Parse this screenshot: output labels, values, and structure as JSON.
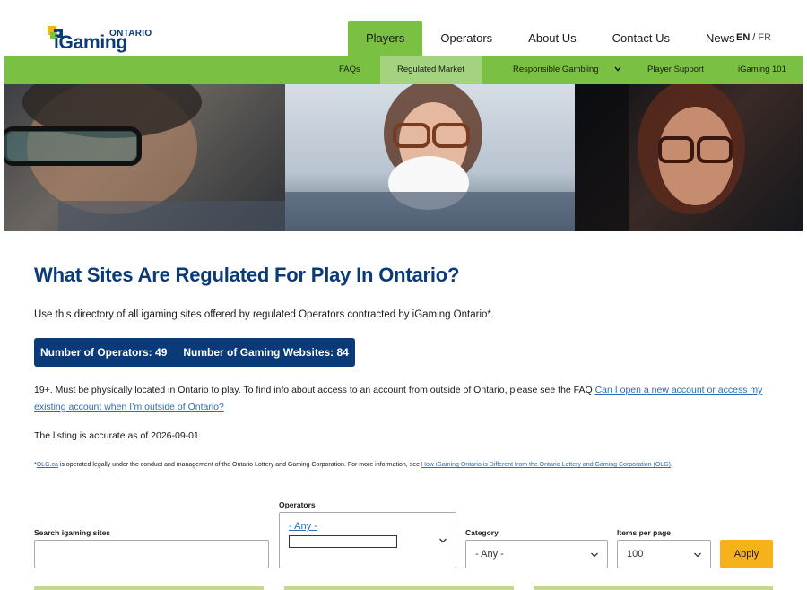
{
  "header": {
    "logo": {
      "top": "ONTARIO",
      "main": "iGaming"
    },
    "nav": [
      {
        "label": "Players",
        "active": true
      },
      {
        "label": "Operators",
        "active": false
      },
      {
        "label": "About Us",
        "active": false
      },
      {
        "label": "Contact Us",
        "active": false
      },
      {
        "label": "News",
        "active": false
      }
    ],
    "lang": {
      "en": "EN",
      "separator": "/",
      "fr": "FR"
    }
  },
  "subnav": [
    {
      "label": "FAQs"
    },
    {
      "label": "Regulated Market",
      "active": true
    },
    {
      "label": "Responsible Gambling",
      "has_dropdown": true
    },
    {
      "label": "Player Support"
    },
    {
      "label": "iGaming 101"
    }
  ],
  "content": {
    "title": "What Sites Are Regulated For Play In Ontario?",
    "intro": "Use this directory of all igaming sites offered by regulated Operators contracted by iGaming Ontario*.",
    "stats": {
      "operators": "Number of Operators: 49",
      "websites": "Number of Gaming Websites: 84"
    },
    "notice_text": "19+. Must be physically located in Ontario to play. To find info about access to an account from outside of Ontario, please see the FAQ ",
    "notice_link": "Can I open a new account or access my existing account when I’m outside of Ontario?",
    "as_of": "The listing is accurate as of 2026-09-01.",
    "fine_prefix": "*",
    "fine_link1": "OLG.ca",
    "fine_mid": " is operated legally under the conduct and management of the Ontario Lottery and Gaming Corporation. For more information, see ",
    "fine_link2": "How iGaming Ontario is Different from the Ontario Lottery and Gaming Corporation (OLG)",
    "fine_end": "."
  },
  "filters": {
    "search": {
      "label": "Search igaming sites",
      "value": ""
    },
    "operators": {
      "label": "Operators",
      "value": "- Any -"
    },
    "category": {
      "label": "Category",
      "value": "- Any -"
    },
    "items_per_page": {
      "label": "Items per page",
      "value": "100"
    },
    "apply_label": "Apply"
  },
  "colors": {
    "brand_blue": "#0b3a78",
    "green": "#7ac143",
    "accent_yellow": "#f6b21a",
    "link": "#2a6db0"
  }
}
